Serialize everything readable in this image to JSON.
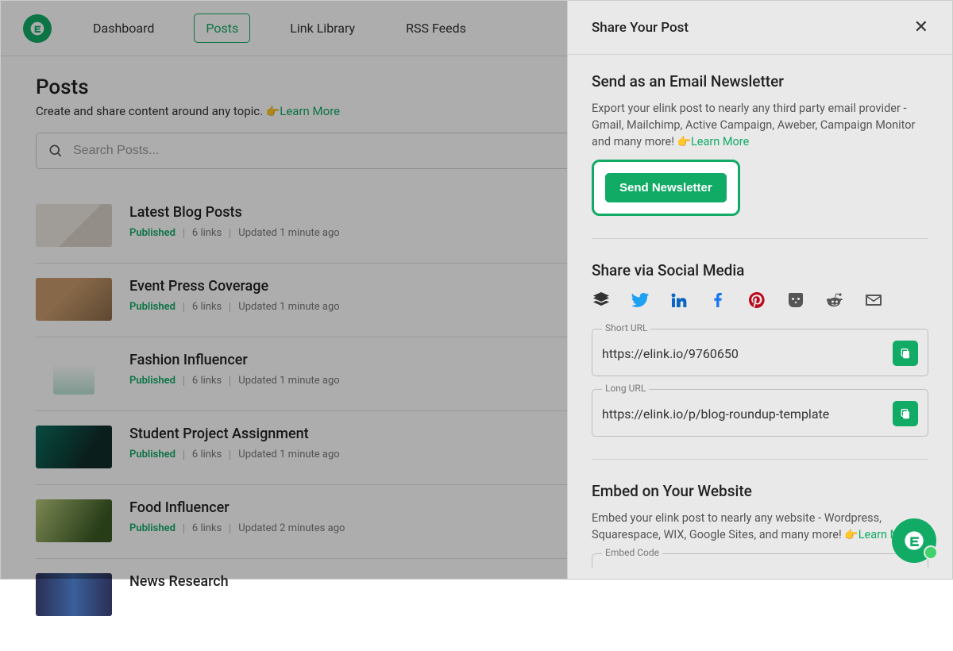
{
  "nav": {
    "items": [
      "Dashboard",
      "Posts",
      "Link Library",
      "RSS Feeds"
    ],
    "active_index": 1
  },
  "page": {
    "title": "Posts",
    "subtitle_pre": "Create and share content around any topic. ",
    "learn_more": "Learn More",
    "search_placeholder": "Search Posts..."
  },
  "posts": [
    {
      "title": "Latest Blog Posts",
      "status": "Published",
      "links": "6 links",
      "updated": "Updated 1 minute ago",
      "thumb": "t1"
    },
    {
      "title": "Event Press Coverage",
      "status": "Published",
      "links": "6 links",
      "updated": "Updated 1 minute ago",
      "thumb": "t2"
    },
    {
      "title": "Fashion Influencer",
      "status": "Published",
      "links": "6 links",
      "updated": "Updated 1 minute ago",
      "thumb": "t3"
    },
    {
      "title": "Student Project Assignment",
      "status": "Published",
      "links": "6 links",
      "updated": "Updated 1 minute ago",
      "thumb": "t4"
    },
    {
      "title": "Food Influencer",
      "status": "Published",
      "links": "6 links",
      "updated": "Updated 2 minutes ago",
      "thumb": "t5"
    },
    {
      "title": "News Research",
      "status": "",
      "links": "",
      "updated": "",
      "thumb": "t6"
    }
  ],
  "panel": {
    "title": "Share Your Post",
    "email_section": {
      "heading": "Send as an Email Newsletter",
      "body": "Export your elink post to nearly any third party email provider - Gmail, Mailchimp, Active Campaign, Aweber, Campaign Monitor and many more! ",
      "learn_more": "Learn More",
      "button": "Send Newsletter"
    },
    "social_section": {
      "heading": "Share via Social Media",
      "short_url_label": "Short URL",
      "short_url": "https://elink.io/9760650",
      "long_url_label": "Long URL",
      "long_url": "https://elink.io/p/blog-roundup-template"
    },
    "embed_section": {
      "heading": "Embed on Your Website",
      "body": "Embed your elink post to nearly any website - Wordpress, Squarespace, WIX, Google Sites, and many more! ",
      "learn_more": "Learn More",
      "embed_label": "Embed Code"
    },
    "social_icons": [
      "buffer",
      "twitter",
      "linkedin",
      "facebook",
      "pinterest",
      "hootsuite",
      "reddit",
      "email"
    ]
  },
  "colors": {
    "accent": "#12ab66"
  }
}
